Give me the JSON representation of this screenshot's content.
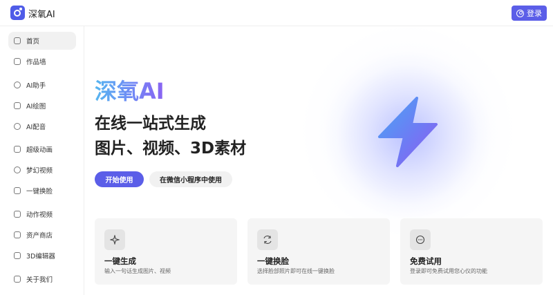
{
  "app": {
    "brand": "深氧AI"
  },
  "header": {
    "login_label": "登录"
  },
  "sidebar": {
    "items": [
      {
        "label": "首页",
        "icon": "home-icon"
      },
      {
        "label": "作品墙",
        "icon": "gallery-icon"
      },
      {
        "label": "AI助手",
        "icon": "assistant-icon"
      },
      {
        "label": "AI绘图",
        "icon": "image-icon"
      },
      {
        "label": "AI配音",
        "icon": "headphones-icon"
      },
      {
        "label": "超级动画",
        "icon": "animation-icon"
      },
      {
        "label": "梦幻视频",
        "icon": "video-icon"
      },
      {
        "label": "一键换脸",
        "icon": "face-swap-icon"
      },
      {
        "label": "动作视频",
        "icon": "motion-video-icon"
      },
      {
        "label": "资产商店",
        "icon": "store-icon"
      },
      {
        "label": "3D编辑器",
        "icon": "cube-icon"
      },
      {
        "label": "关于我们",
        "icon": "info-icon"
      }
    ]
  },
  "hero": {
    "brand": "深氧AI",
    "line1": "在线一站式生成",
    "line2": "图片、视频、3D素材",
    "primary_btn": "开始使用",
    "secondary_btn": "在微信小程序中使用",
    "icon": "lightning-icon"
  },
  "cards": [
    {
      "title": "一键生成",
      "desc": "输入一句话生成图片、视频",
      "icon": "sparkle-icon"
    },
    {
      "title": "一键换脸",
      "desc": "选择脸部照片即可在线一键换脸",
      "icon": "swap-icon"
    },
    {
      "title": "免费试用",
      "desc": "登录即可免费试用您心仪的功能",
      "icon": "chat-icon"
    }
  ],
  "colors": {
    "accent": "#5b5ee8",
    "card_bg": "#f5f5f5"
  }
}
